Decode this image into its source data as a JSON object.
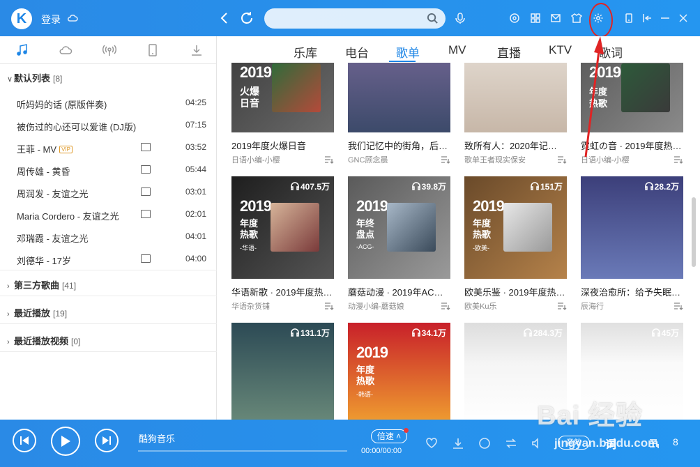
{
  "topbar": {
    "logo": "K",
    "login_label": "登录"
  },
  "sidebar": {
    "sections": [
      {
        "title": "默认列表",
        "count": "[8]",
        "expanded": true
      },
      {
        "title": "第三方歌曲",
        "count": "[41]"
      },
      {
        "title": "最近播放",
        "count": "[19]"
      },
      {
        "title": "最近播放视频",
        "count": "[0]"
      }
    ],
    "songs": [
      {
        "title": "听妈妈的话 (原版伴奏)",
        "duration": "04:25",
        "mv": false
      },
      {
        "title": "被伤过的心还可以爱谁 (DJ版)",
        "duration": "07:15",
        "mv": false
      },
      {
        "title": "王菲 - MV",
        "duration": "03:52",
        "mv": true,
        "vip": "VIP"
      },
      {
        "title": "周传雄 - 黄昏",
        "duration": "05:44",
        "mv": true
      },
      {
        "title": "周润发 - 友谊之光",
        "duration": "03:01",
        "mv": true
      },
      {
        "title": "Maria Cordero - 友谊之光",
        "duration": "02:01",
        "mv": true
      },
      {
        "title": "邓瑞霞 - 友谊之光",
        "duration": "04:01",
        "mv": false
      },
      {
        "title": "刘德华 - 17岁",
        "duration": "04:00",
        "mv": true
      }
    ]
  },
  "nav": {
    "tabs": [
      "乐库",
      "电台",
      "歌单",
      "MV",
      "直播",
      "KTV",
      "歌词"
    ],
    "active": "歌单"
  },
  "cards_row1": [
    {
      "cover_text": "2019",
      "cover_sub": "火爆日音",
      "title": "2019年度火爆日音",
      "author": "日语小编-小樱"
    },
    {
      "title": "我们记忆中的街角，后…",
      "author": "GNC顾念晨"
    },
    {
      "title": "致所有人：2020年记…",
      "author": "歌单王者现实保安"
    },
    {
      "cover_text": "2019",
      "cover_sub": "年度热歌",
      "title": "霓虹の音 · 2019年度热…",
      "author": "日语小编-小樱"
    }
  ],
  "cards_row2": [
    {
      "plays": "407.5万",
      "cover_text": "2019",
      "cover_sub": "年度热歌",
      "cover_tag": "-华语-",
      "title": "华语新歌 · 2019年度热…",
      "author": "华语杂货铺"
    },
    {
      "plays": "39.8万",
      "cover_text": "2019",
      "cover_sub": "年终盘点",
      "cover_tag": "-ACG-",
      "title": "蘑菇动漫 · 2019年AC…",
      "author": "动漫小编-蘑菇娘"
    },
    {
      "plays": "151万",
      "cover_text": "2019",
      "cover_sub": "年度热歌",
      "cover_tag": "-欧美-",
      "title": "欧美乐鉴 · 2019年度热…",
      "author": "欧美Ku乐"
    },
    {
      "plays": "28.2万",
      "title": "深夜治愈所：给予失眠…",
      "author": "辰海行"
    }
  ],
  "cards_row3": [
    {
      "plays": "131.1万"
    },
    {
      "plays": "34.1万",
      "cover_text": "2019",
      "cover_sub": "年度热歌",
      "cover_tag": "-韩语-"
    },
    {
      "plays": "284.3万"
    },
    {
      "plays": "45万"
    }
  ],
  "player": {
    "title": "酷狗音乐",
    "speed": "倍速",
    "time": "00:00/00:00",
    "sound": "音效",
    "lyric": "词",
    "queue": "8"
  },
  "watermark": {
    "brand": "Bai 经验",
    "url": "jingyan.baidu.com"
  },
  "colors": {
    "accent": "#1e86e6",
    "annotation": "#e02424"
  }
}
